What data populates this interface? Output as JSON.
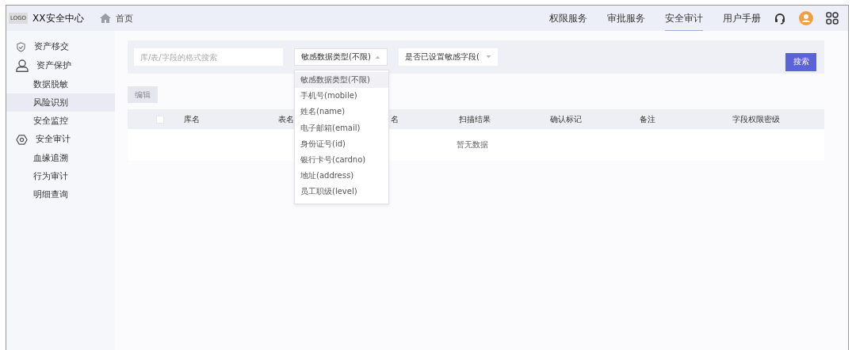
{
  "header": {
    "logo": "LOGO",
    "title": "XX安全中心",
    "home": "首页",
    "nav": [
      {
        "label": "权限服务",
        "selected": false
      },
      {
        "label": "审批服务",
        "selected": false
      },
      {
        "label": "安全审计",
        "selected": true
      },
      {
        "label": "用户手册",
        "selected": false
      }
    ]
  },
  "sidebar": {
    "groups": [
      {
        "label": "资产移交"
      },
      {
        "label": "资产保护",
        "children": [
          {
            "label": "数据脱敏",
            "selected": false
          },
          {
            "label": "风险识别",
            "selected": true
          },
          {
            "label": "安全监控",
            "selected": false
          }
        ]
      },
      {
        "label": "安全审计",
        "children": [
          {
            "label": "血缘追溯",
            "selected": false
          },
          {
            "label": "行为审计",
            "selected": false
          },
          {
            "label": "明细查询",
            "selected": false
          }
        ]
      }
    ]
  },
  "filters": {
    "search": {
      "placeholder": "库/表/字段的格式搜索"
    },
    "type_select": {
      "value": "敏感数据类型(不限)",
      "expanded": true
    },
    "set_select": {
      "value": "是否已设置敏感字段(",
      "expanded": false
    },
    "search_button": "搜索"
  },
  "edit_button": {
    "label": "编辑",
    "disabled": true
  },
  "table": {
    "select_all": {
      "checked": false
    },
    "columns": [
      "库名",
      "表名",
      "名",
      "扫描结果",
      "确认标记",
      "备注",
      "字段权限密级"
    ],
    "empty_text": "暂无数据"
  },
  "dropdown": {
    "options": [
      {
        "label": "敏感数据类型(不限)",
        "selected": true
      },
      {
        "label": "手机号(mobile)",
        "selected": false
      },
      {
        "label": "姓名(name)",
        "selected": false
      },
      {
        "label": "电子邮箱(email)",
        "selected": false
      },
      {
        "label": "身份证号(id)",
        "selected": false
      },
      {
        "label": "银行卡号(cardno)",
        "selected": false
      },
      {
        "label": "地址(address)",
        "selected": false
      },
      {
        "label": "员工职级(level)",
        "selected": false
      }
    ]
  }
}
